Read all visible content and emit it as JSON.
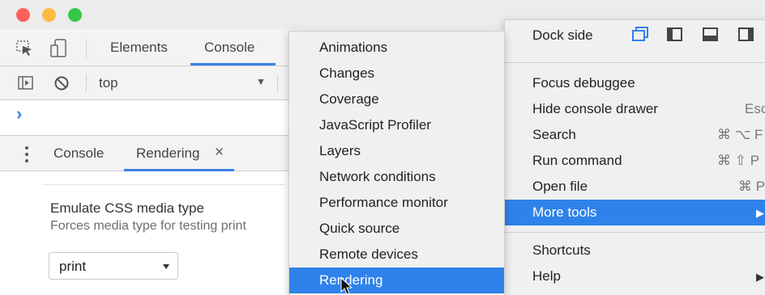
{
  "toolbar": {
    "tabs": [
      "Elements",
      "Console"
    ]
  },
  "filterbar": {
    "context": "top"
  },
  "console": {
    "prompt": "›"
  },
  "drawer": {
    "tabs": [
      "Console",
      "Rendering"
    ],
    "close_glyph": "×",
    "emulate_title": "Emulate CSS media type",
    "emulate_desc": "Forces media type for testing print",
    "media_value": "print"
  },
  "main_menu": {
    "dock_side": "Dock side",
    "items": [
      {
        "label": "Focus debuggee",
        "shortcut": ""
      },
      {
        "label": "Hide console drawer",
        "shortcut": "Esc"
      },
      {
        "label": "Search",
        "shortcut": "⌘ ⌥ F"
      },
      {
        "label": "Run command",
        "shortcut": "⌘ ⇧ P"
      },
      {
        "label": "Open file",
        "shortcut": "⌘ P"
      },
      {
        "label": "More tools",
        "shortcut": "▶"
      },
      {
        "label": "Shortcuts",
        "shortcut": ""
      },
      {
        "label": "Help",
        "shortcut": "▶"
      }
    ]
  },
  "more_tools_menu": {
    "items": [
      "Animations",
      "Changes",
      "Coverage",
      "JavaScript Profiler",
      "Layers",
      "Network conditions",
      "Performance monitor",
      "Quick source",
      "Remote devices",
      "Rendering"
    ]
  },
  "colors": {
    "accent": "#2f82ea",
    "tab_underline": "#3b82e6",
    "prompt": "#3b82e6"
  }
}
